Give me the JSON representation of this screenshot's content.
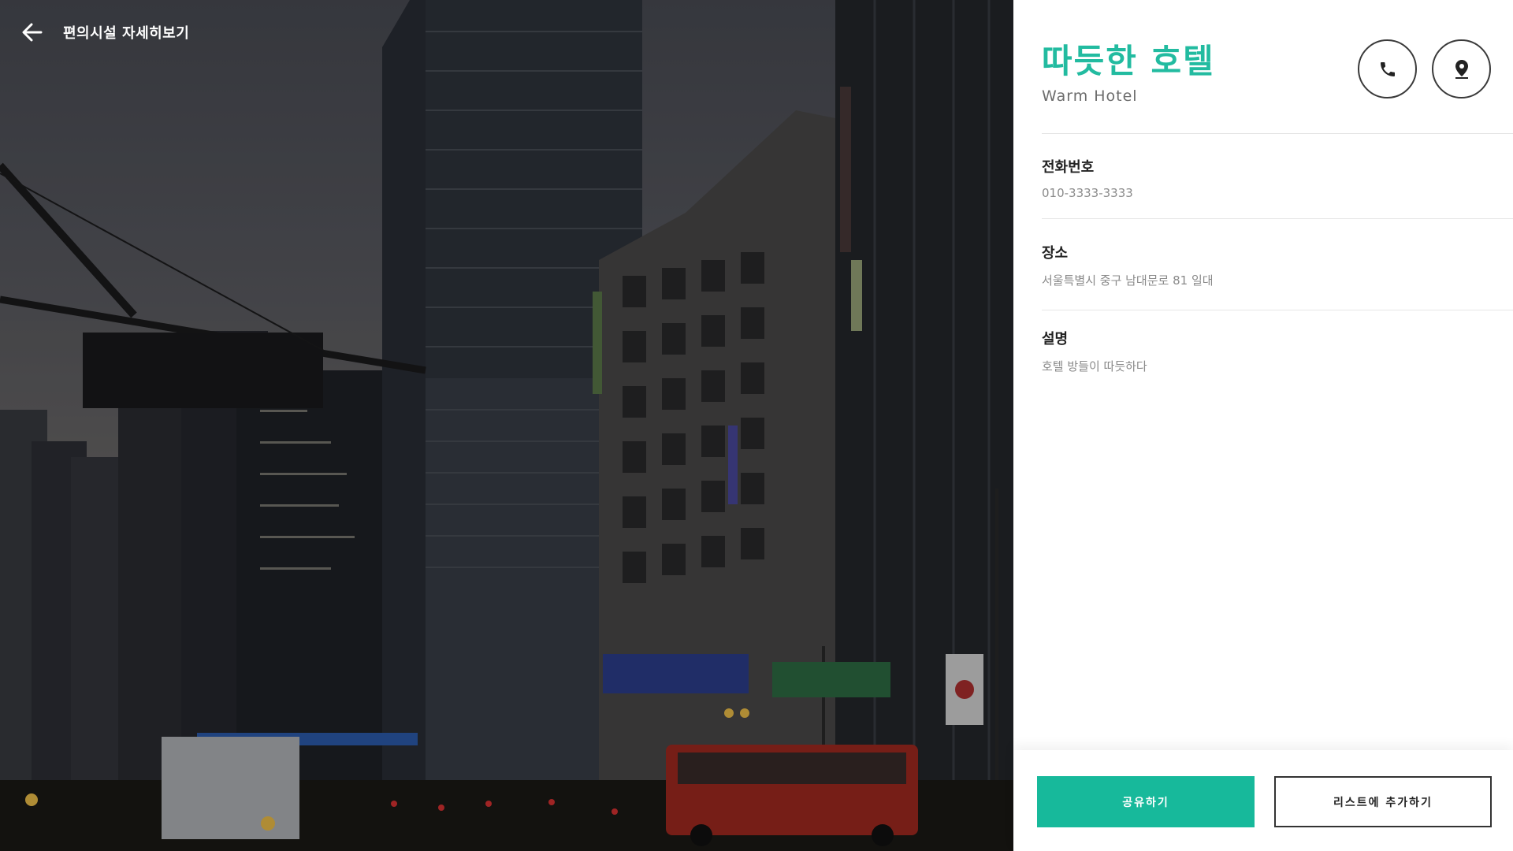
{
  "page": {
    "title": "편의시설 자세히보기",
    "back_icon": "arrow-left-icon"
  },
  "facility": {
    "name_ko": "따듯한 호텔",
    "name_en": "Warm Hotel",
    "accent_color": "#22bba0"
  },
  "actions": {
    "call_icon": "phone-icon",
    "map_icon": "map-pin-icon"
  },
  "details": [
    {
      "label": "전화번호",
      "value": "010-3333-3333"
    },
    {
      "label": "장소",
      "value": "서울특별시 중구 남대문로 81 일대"
    },
    {
      "label": "설명",
      "value": "호텔 방들이 따듯하다"
    }
  ],
  "footer": {
    "share_label": "공유하기",
    "add_list_label": "리스트에 추가하기",
    "share_color": "#17b99b"
  }
}
